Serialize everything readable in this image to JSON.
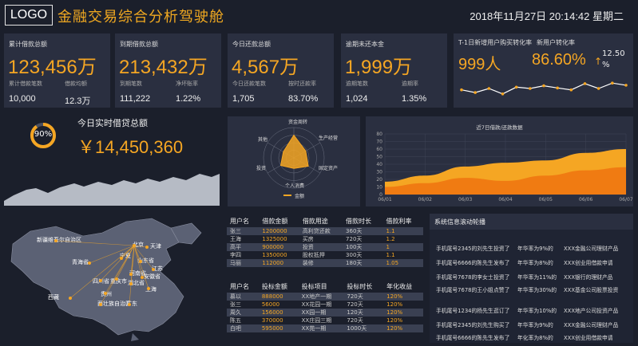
{
  "header": {
    "logo": "LOGO",
    "title": "金融交易综合分析驾驶舱",
    "datetime": "2018年11月27日  20:14:42  星期二"
  },
  "kpis": [
    {
      "label": "累计借款总额",
      "value": "123,456万",
      "sub1_label": "累计借款笔数",
      "sub1_value": "10,000",
      "sub2_label": "借款均额",
      "sub2_value": "12.3万"
    },
    {
      "label": "到期借款总额",
      "value": "213,432万",
      "sub1_label": "到期笔数",
      "sub1_value": "111,222",
      "sub2_label": "净坏账率",
      "sub2_value": "1.22%"
    },
    {
      "label": "今日还款总额",
      "value": "4,567万",
      "sub1_label": "今日还款笔数",
      "sub1_value": "1,705",
      "sub2_label": "按时还款率",
      "sub2_value": "83.70%"
    },
    {
      "label": "逾期未还本金",
      "value": "1,999万",
      "sub1_label": "逾期笔数",
      "sub1_value": "1,024",
      "sub2_label": "逾期率",
      "sub2_value": "1.35%"
    }
  ],
  "conversion": {
    "label": "T-1日新增用户购买转化率",
    "label2": "新用户转化率",
    "users": "999人",
    "rate": "86.60%",
    "arrow": "↑",
    "change": "12.50",
    "change_unit": "%",
    "trend": [
      0.45,
      0.35,
      0.5,
      0.3,
      0.55,
      0.5,
      0.6,
      0.52,
      0.45,
      0.68,
      0.5,
      0.7,
      0.62
    ]
  },
  "realtime": {
    "percent_label": "90%",
    "percent": 0.9,
    "label": "今日实时借贷总额",
    "value": "￥14,450,360"
  },
  "radar": {
    "axes": [
      "资金周转",
      "生产经营",
      "固定资产",
      "个人消费",
      "投资",
      "其他"
    ],
    "values": [
      0.75,
      0.45,
      0.55,
      0.35,
      0.5,
      0.4
    ],
    "legend": "金额"
  },
  "chart_data": {
    "type": "area",
    "title": "近7日借款/还款数据",
    "x": [
      "06/01",
      "06/02",
      "06/03",
      "06/04",
      "06/05",
      "06/06",
      "06/07"
    ],
    "ylim": [
      0,
      80
    ],
    "yticks": [
      0,
      10,
      20,
      30,
      40,
      50,
      60,
      70,
      80
    ],
    "series": [
      {
        "values": [
          17,
          25,
          37,
          42,
          45,
          55,
          60
        ],
        "color": "#f5a623"
      },
      {
        "values": [
          10,
          15,
          22,
          18,
          25,
          32,
          36
        ],
        "color": "#f07b12"
      }
    ]
  },
  "map": {
    "labels": [
      "新疆维吾尔自治区",
      "青海省",
      "宁夏",
      "北京",
      "天津",
      "山东省",
      "河南省",
      "四川省",
      "重庆市",
      "湖北省",
      "安徽省",
      "江苏",
      "上海",
      "西藏",
      "贵州",
      "西壮族自治区",
      "广东"
    ]
  },
  "table1": {
    "headers": [
      "用户名",
      "借款金额",
      "借款用途",
      "借款时长",
      "借款利率"
    ],
    "rows": [
      [
        "张三",
        "1200000",
        "高利贷还款",
        "360天",
        "1.1"
      ],
      [
        "王海",
        "1325000",
        "买房",
        "720天",
        "1.2"
      ],
      [
        "高平",
        "900000",
        "投资",
        "100天",
        "1"
      ],
      [
        "李四",
        "1350000",
        "股权抵押",
        "300天",
        "1.1"
      ],
      [
        "马丽",
        "112000",
        "装修",
        "180天",
        "1.05"
      ]
    ]
  },
  "table2": {
    "headers": [
      "用户名",
      "投标金额",
      "投标项目",
      "投标时长",
      "年化收益"
    ],
    "rows": [
      [
        "慕以",
        "888000",
        "XX地产一期",
        "720天",
        "120%"
      ],
      [
        "张三",
        "56000",
        "XX花园一期",
        "720天",
        "120%"
      ],
      [
        "周久",
        "156000",
        "XX园一期",
        "120天",
        "120%"
      ],
      [
        "陈五",
        "370000",
        "XX庄园三期",
        "720天",
        "120%"
      ],
      [
        "白吧",
        "595000",
        "XX苑一期",
        "1000天",
        "120%"
      ]
    ]
  },
  "feed": {
    "title": "系统信息滚动轮播",
    "rows": [
      [
        "手机尾号2345的刘先生",
        "投资了",
        "年华率为9%的",
        "XXX金融公司理财产品"
      ],
      [
        "手机尾号6666的陈先生",
        "发布了",
        "年华率为8%的",
        "XXX创业用借款申请"
      ],
      [
        "手机尾号7678的李女士",
        "投资了",
        "年华率为11%的",
        "XXX银行的理财产品"
      ],
      [
        "手机尾号7678的王小姐",
        "点赞了",
        "年华率为30%的",
        "XXX基金公司股票投资"
      ],
      [
        "手机尾号1234的杨先生",
        "逛订了",
        "年华率为10%的",
        "XXX地产公司投资产品"
      ],
      [
        "手机尾号2345的刘先生",
        "购买了",
        "年华率为9%的",
        "XXX金融公司理财产品"
      ],
      [
        "手机尾号6666的陈先生",
        "发布了",
        "年化率为8%的",
        "XXX创业用借款申请"
      ]
    ]
  },
  "colors": {
    "accent": "#f5a623",
    "panel": "#2a2f40",
    "bg": "#1b1f2b"
  }
}
